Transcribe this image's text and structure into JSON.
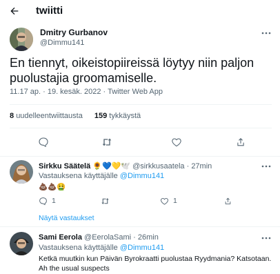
{
  "header": {
    "title": "twiitti"
  },
  "tweet": {
    "author_name": "Dmitry Gurbanov",
    "author_handle": "@Dimmu141",
    "text": "En tiennyt, oikeistopiireissä löytyy niin paljon puolustajia groomamiselle.",
    "meta": "11.17 ap. · 19. kesäk. 2022 · Twitter Web App",
    "retweets_count": "8",
    "retweets_label": "uudelleentwiittausta",
    "likes_count": "159",
    "likes_label": "tykkäystä"
  },
  "replies": [
    {
      "name": "Sirkku Säätelä",
      "name_emojis": "🌻💙💛🕊️",
      "handle": "@sirkkusaatela",
      "time": "27min",
      "reply_to_prefix": "Vastauksena käyttäjälle",
      "reply_to_handle": "@Dimmu141",
      "body": "💩💩🤮",
      "reply_count": "1",
      "like_count": "1",
      "show_replies": "Näytä vastaukset"
    },
    {
      "name": "Sami Eerola",
      "handle": "@EerolaSami",
      "time": "26min",
      "reply_to_prefix": "Vastauksena käyttäjälle",
      "reply_to_handle": "@Dimmu141",
      "body": "Ketkä muutkin kun Päivän Byrokraatti puolustaa Ryydmania? Katsotaan. Ah the usual suspects"
    }
  ],
  "colors": {
    "accent": "#1d9bf0",
    "text": "#0f1419",
    "muted": "#536471",
    "divider": "#eff3f4"
  }
}
